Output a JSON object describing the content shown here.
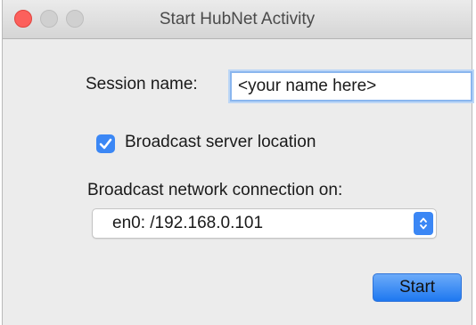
{
  "window": {
    "title": "Start HubNet Activity"
  },
  "session": {
    "label": "Session name:",
    "value": "<your name here>"
  },
  "broadcast": {
    "label": "Broadcast server location",
    "checked": true
  },
  "network": {
    "label": "Broadcast network connection on:",
    "selected": "en0: /192.168.0.101"
  },
  "actions": {
    "start_label": "Start"
  },
  "colors": {
    "accent": "#3b87f5",
    "close": "#fc605c"
  }
}
